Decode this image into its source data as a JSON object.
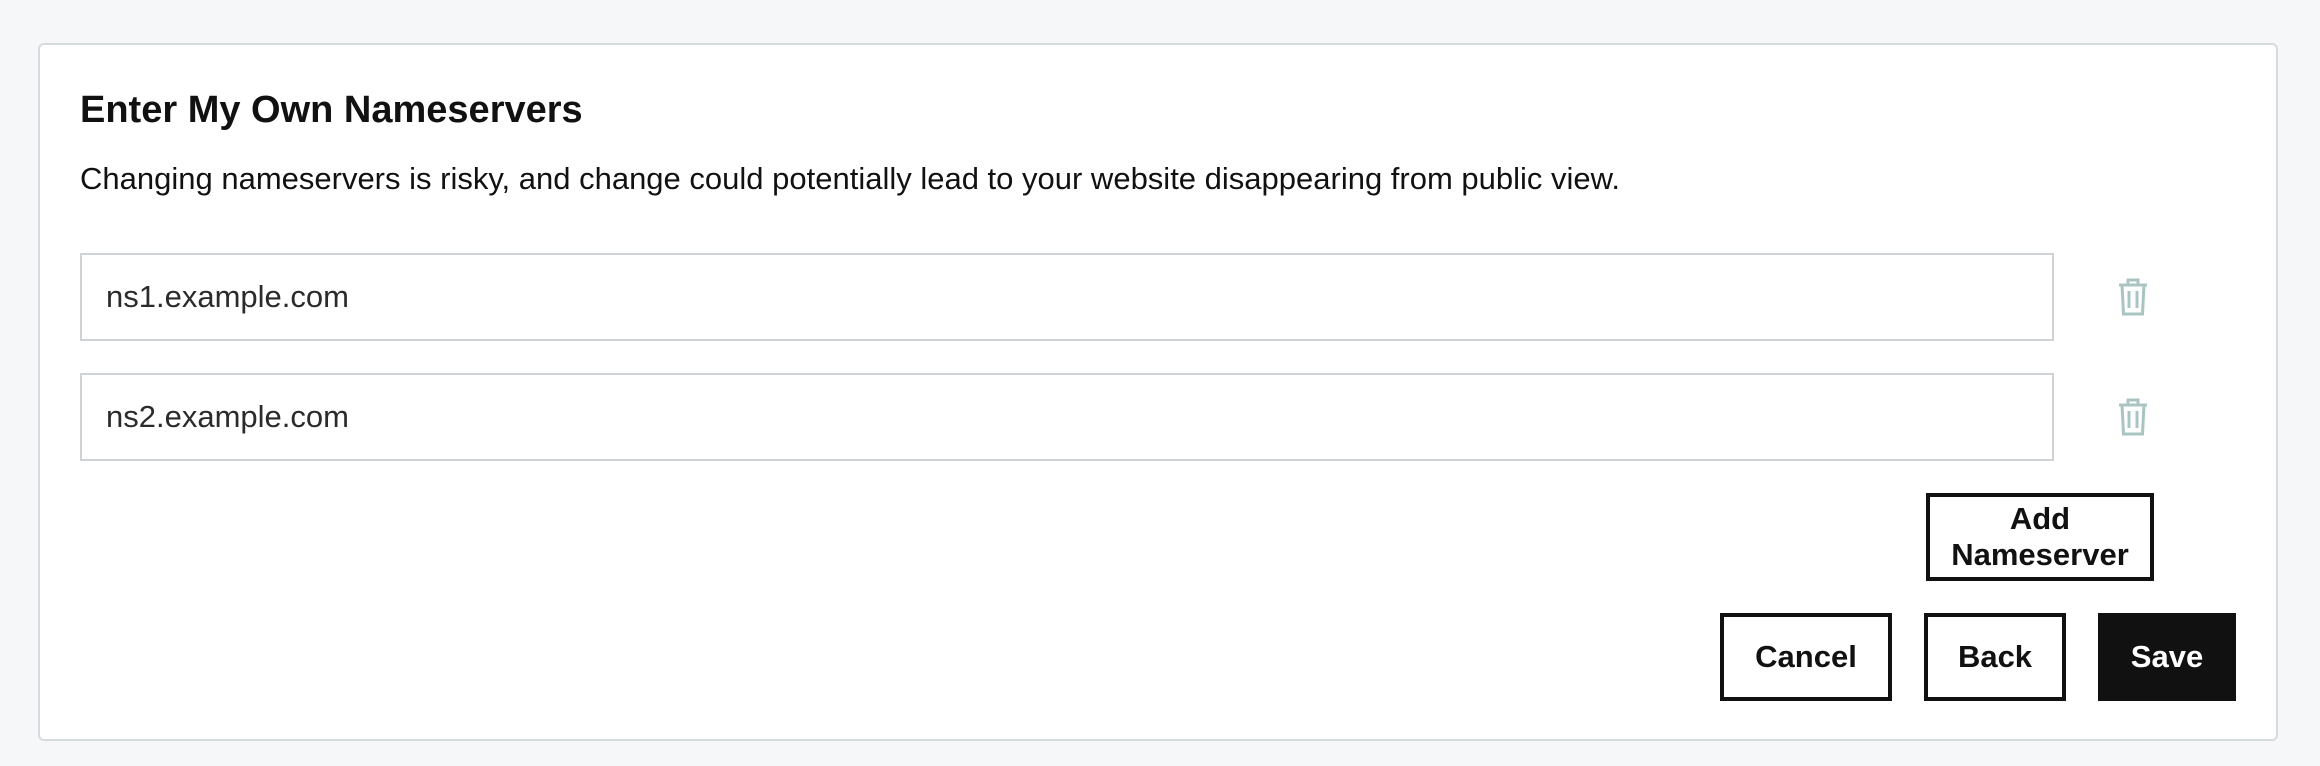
{
  "nameservers": {
    "title": "Enter My Own Nameservers",
    "description": "Changing nameservers is risky, and change could potentially lead to your website disappearing from public view.",
    "entries": [
      {
        "value": "ns1.example.com",
        "delete_icon": "trash-icon"
      },
      {
        "value": "ns2.example.com",
        "delete_icon": "trash-icon"
      }
    ],
    "add_label": "Add Nameserver",
    "cancel_label": "Cancel",
    "back_label": "Back",
    "save_label": "Save"
  },
  "colors": {
    "primary_button": "#111111",
    "trash_icon": "#a9c4c2",
    "input_border": "#cfd3d5",
    "page_background": "#f5f7f8"
  }
}
